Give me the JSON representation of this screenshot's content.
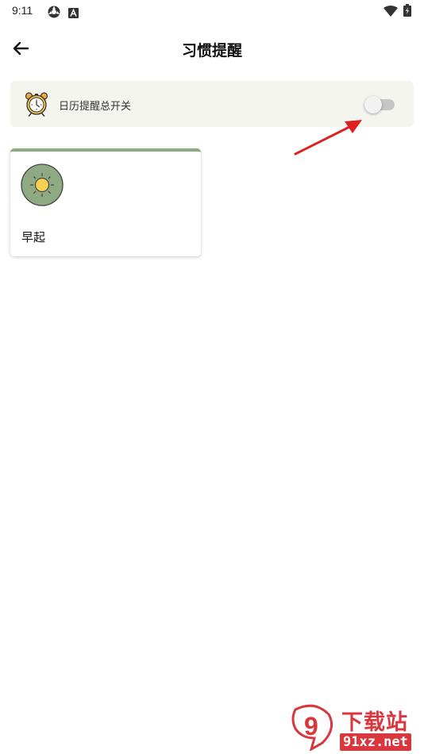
{
  "status_bar": {
    "time": "9:11"
  },
  "header": {
    "back_icon": "arrow-left-icon",
    "title": "习惯提醒"
  },
  "master_switch": {
    "icon": "alarm-clock-icon",
    "label": "日历提醒总开关",
    "enabled": false
  },
  "habits": [
    {
      "icon": "sun-icon",
      "name": "早起",
      "accent_color": "#8daa82"
    }
  ],
  "watermark": {
    "logo_text": "9",
    "title": "下载站",
    "site": "91xz.net"
  },
  "colors": {
    "annotation_arrow": "#e02020",
    "card_background": "#f5f5f0",
    "habit_accent": "#8daa82",
    "watermark_red": "#d9363e"
  }
}
